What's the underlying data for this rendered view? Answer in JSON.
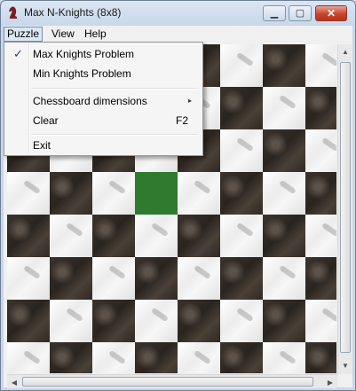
{
  "window": {
    "title": "Max N-Knights (8x8)",
    "icons": {
      "app": "knight-icon",
      "minimize": "minimize-icon",
      "maximize": "maximize-icon",
      "close": "close-icon"
    },
    "minimize_glyph": "▁",
    "maximize_glyph": "▢",
    "close_glyph": "✕"
  },
  "menubar": {
    "items": [
      "Puzzle",
      "View",
      "Help"
    ]
  },
  "puzzle_menu": {
    "max_knights": {
      "label": "Max Knights Problem",
      "checked": true,
      "check_glyph": "✓"
    },
    "min_knights": {
      "label": "Min Knights Problem"
    },
    "dimensions": {
      "label": "Chessboard dimensions",
      "submenu_glyph": "▸"
    },
    "clear": {
      "label": "Clear",
      "shortcut": "F2"
    },
    "exit": {
      "label": "Exit"
    }
  },
  "board": {
    "size": "8x8",
    "highlighted_square": {
      "row": 3,
      "col": 3
    },
    "colors": {
      "dark": "#3b332d",
      "light": "#f2f2f2",
      "highlight": "#2e7a2e"
    }
  },
  "scrollbars": {
    "up_glyph": "▲",
    "down_glyph": "▼",
    "left_glyph": "◀",
    "right_glyph": "▶"
  }
}
